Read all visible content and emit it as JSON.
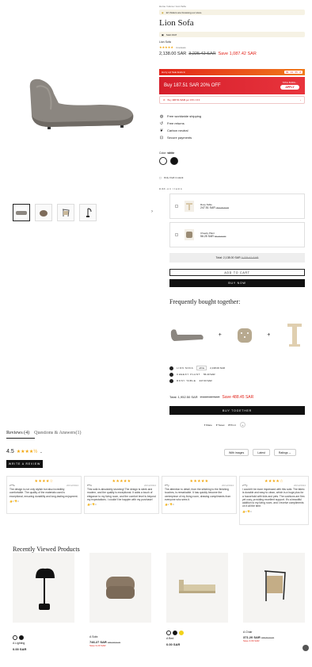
{
  "breadcrumb": "Home / Home / Lion Sofa",
  "visitors": "22 Visitors are browsing our store.",
  "product": {
    "title": "Lion Sofa",
    "sold": "Sold 1947",
    "vendor": "Lion Sofa",
    "reviews_count": "4 reviews",
    "price": "2,138.00 SAR",
    "compare_price": "3,225.42 SAR",
    "save": "Save 1,087.42 SAR"
  },
  "promo": {
    "flash_label": "Hurry up! Sale Ends In",
    "timer": "09 : 33 : 55 : 8",
    "deal_text": "Buy 187.51 SAR 20% OFF",
    "apply_top": "TOTAL BUNDL...",
    "apply_label": "APPLY",
    "promo3_prefix": "Buy ",
    "promo3_price": "187.51 SAR",
    "promo3_suffix": " get 15% OFF",
    "promo3_chevron": "›"
  },
  "features": [
    {
      "icon": "globe-icon",
      "text": "Free worldwide shipping"
    },
    {
      "icon": "return-icon",
      "text": "Free returns"
    },
    {
      "icon": "leaf-icon",
      "text": "Carbon neutral"
    },
    {
      "icon": "lock-icon",
      "text": "Secure payments"
    }
  ],
  "color": {
    "label": "Color: ",
    "value": "white",
    "swatches": [
      "#ffffff",
      "#111111"
    ]
  },
  "stock": "Only 3 left in stock",
  "addons": {
    "title": "Add-on items",
    "items": [
      {
        "name": "Rosy Table",
        "price": "247.51 SAR",
        "compare": "297.03 SAR"
      },
      {
        "name": "Cheeky Plant",
        "price": "56.25 SAR",
        "compare": "56.40 SAR"
      }
    ]
  },
  "total": {
    "label": "Total: 2,138.00 SAR",
    "compare": "3,225.42 SAR"
  },
  "buttons": {
    "add_to_cart": "ADD TO CART",
    "buy_now": "BUY NOW",
    "buy_together": "BUY TOGETHER",
    "write_review": "WRITE A REVIEW"
  },
  "fbt": {
    "title": "Frequently bought together:",
    "items": [
      {
        "name": "LION SOFA",
        "variant": "white",
        "price": "2,138.00 SAR"
      },
      {
        "name": "CHEEKY PLANT",
        "variant": "",
        "price": "56.40 SAR"
      },
      {
        "name": "ROSY TABLE",
        "variant": "",
        "price": "247.03 SAR"
      }
    ],
    "total": "Total: 1,952.50 SAR",
    "compare": "2,442.43 SAR",
    "save": "Save 488.45 SAR"
  },
  "share": {
    "share": "Share",
    "tweet": "Tweet",
    "pin": "Pin it"
  },
  "reviews": {
    "tab_reviews": "Reviews (4)",
    "tab_qa": "Questions & Answers(1)",
    "rating": "4.5",
    "filters": [
      "With images",
      "Latest",
      "Ratings"
    ],
    "cards": [
      {
        "name": "c***s",
        "date": "20/12/2024",
        "stars": "★★★★☆",
        "text": "The design is not only stylish but also incredibly comfortable. The quality of the materials used is exceptional, ensuring durability and long-lasting enjoyment.",
        "likes": "0",
        "dislikes": "0"
      },
      {
        "name": "f***n",
        "date": "20/12/2024",
        "stars": "★★★★★",
        "text": "This sofa is absolutely stunning! The design is sleek and modern, and the quality is exceptional. It adds a touch of elegance to my living room, and the comfort level is beyond my expectations. I couldn't be happier with my purchase!",
        "likes": "0",
        "dislikes": "0"
      },
      {
        "name": "l***y",
        "date": "20/12/2024",
        "stars": "★★★★★",
        "text": "The attention to detail, from the stitching to the finishing touches, is remarkable. It has quickly become the centerpiece of my living room, drawing compliments from everyone who sees it.",
        "likes": "1",
        "dislikes": "0"
      },
      {
        "name": "c***y",
        "date": "20/12/2024",
        "stars": "★★★★☆",
        "text": "I couldn't be more impressed with this sofa. The fabric is durable and easy to clean, which is a huge plus for a household with kids and pets. The cushions are firm yet cozy, providing excellent support. It's a beautiful addition to my living room, and I receive compliments on it all the time.",
        "likes": "0",
        "dislikes": "0"
      }
    ]
  },
  "recent": {
    "title": "Recently Viewed Products",
    "items": [
      {
        "name": "A Lighting",
        "price": "0.00 SAR",
        "compare": "",
        "save": "",
        "swatches": [
          "#ffffff",
          "#111111"
        ]
      },
      {
        "name": "A Sofa",
        "price": "746.27 SAR",
        "compare": "755.48 SAR",
        "save": "Save 9.20 SAR",
        "swatches": []
      },
      {
        "name": "A Bed",
        "price": "0.00 SAR",
        "compare": "",
        "save": "",
        "swatches": [
          "#ffffff",
          "#111111",
          "#f2d21a"
        ]
      },
      {
        "name": "A Chair",
        "price": "371.20 SAR",
        "compare": "375.54 SAR",
        "save": "Save 3.96 SAR",
        "swatches": []
      }
    ]
  },
  "colors": {
    "accent": "#e2231a",
    "star": "#f2a50c",
    "dark": "#111111"
  }
}
